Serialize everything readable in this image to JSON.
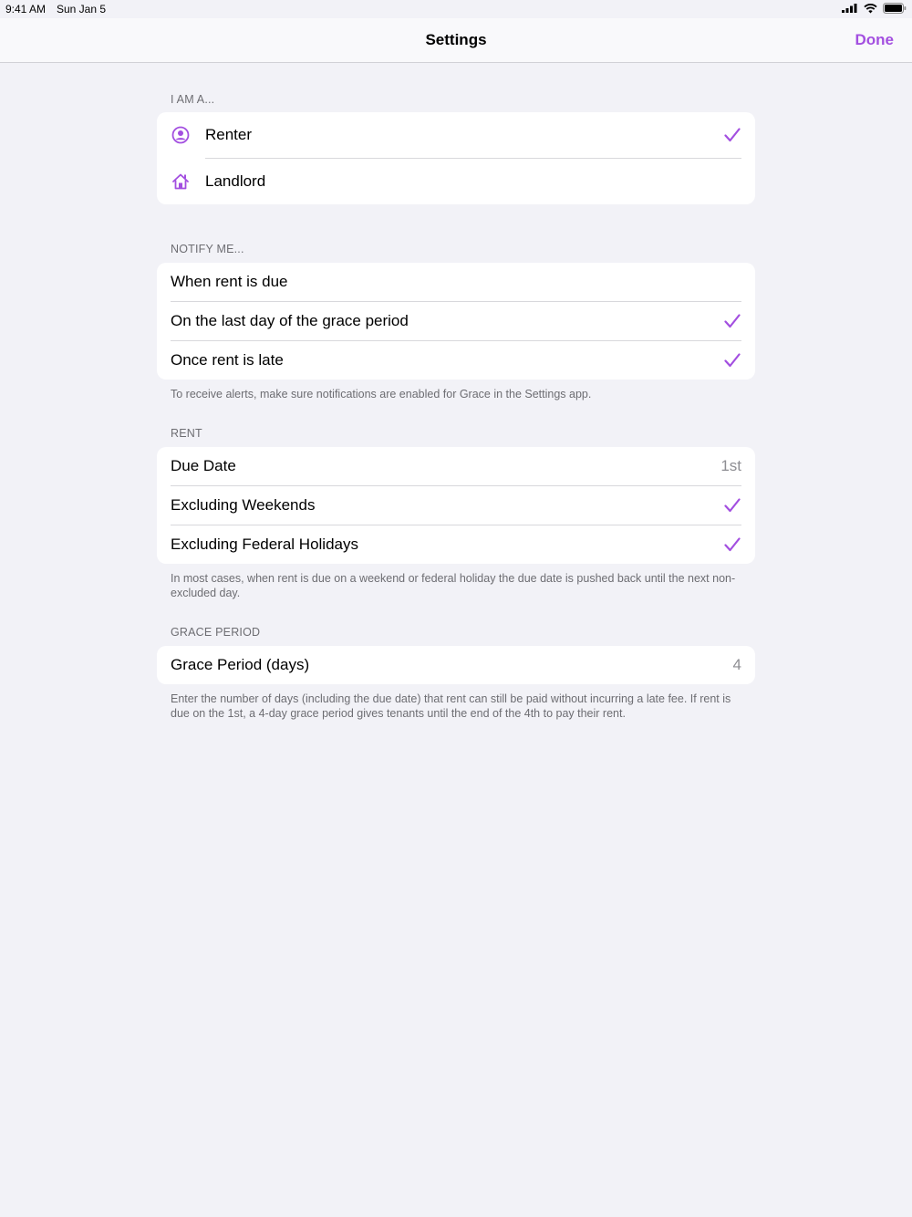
{
  "status": {
    "time": "9:41 AM",
    "date": "Sun Jan 5"
  },
  "nav": {
    "title": "Settings",
    "done_label": "Done"
  },
  "accent": "#a34fe0",
  "sections": {
    "iama": {
      "header": "I AM A...",
      "rows": [
        {
          "label": "Renter",
          "icon": "person-circle-icon",
          "checked": true
        },
        {
          "label": "Landlord",
          "icon": "house-icon",
          "checked": false
        }
      ]
    },
    "notify": {
      "header": "NOTIFY ME...",
      "rows": [
        {
          "label": "When rent is due",
          "checked": false
        },
        {
          "label": "On the last day of the grace period",
          "checked": true
        },
        {
          "label": "Once rent is late",
          "checked": true
        }
      ],
      "footer": "To receive alerts, make sure notifications are enabled for Grace in the Settings app."
    },
    "rent": {
      "header": "RENT",
      "rows": [
        {
          "label": "Due Date",
          "value": "1st"
        },
        {
          "label": "Excluding Weekends",
          "checked": true
        },
        {
          "label": "Excluding Federal Holidays",
          "checked": true
        }
      ],
      "footer": "In most cases, when rent is due on a weekend or federal holiday the due date is pushed back until the next non-excluded day."
    },
    "grace": {
      "header": "GRACE PERIOD",
      "rows": [
        {
          "label": "Grace Period (days)",
          "value": "4"
        }
      ],
      "footer": "Enter the number of days (including the due date) that rent can still be paid without incurring a late fee. If rent is due on the 1st, a 4-day grace period gives tenants until the end of the 4th to pay their rent."
    }
  }
}
